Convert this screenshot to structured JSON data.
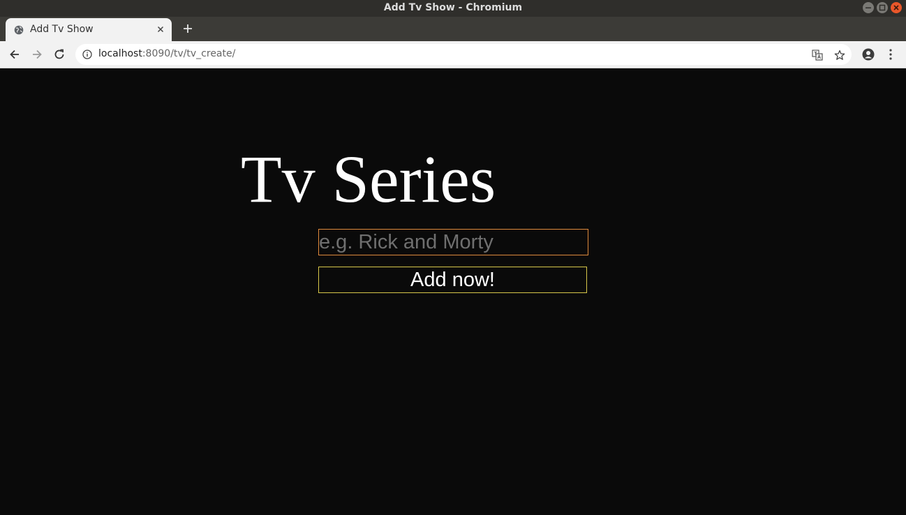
{
  "window": {
    "title": "Add Tv Show - Chromium"
  },
  "tabs": [
    {
      "label": "Add Tv Show",
      "icon": "globe-icon"
    }
  ],
  "toolbar": {
    "url_host": "localhost",
    "url_rest": ":8090/tv/tv_create/",
    "icons": [
      "back-icon",
      "forward-icon",
      "reload-icon",
      "info-icon",
      "translate-icon",
      "star-icon",
      "account-icon",
      "menu-icon"
    ]
  },
  "page": {
    "title": "Tv Series",
    "input_placeholder": "e.g. Rick and Morty",
    "input_value": "",
    "button_label": "Add now!"
  },
  "colors": {
    "background": "#0a0a0a",
    "input_border": "#e08a3c",
    "button_border": "#d8c84a",
    "text": "#ffffff"
  }
}
